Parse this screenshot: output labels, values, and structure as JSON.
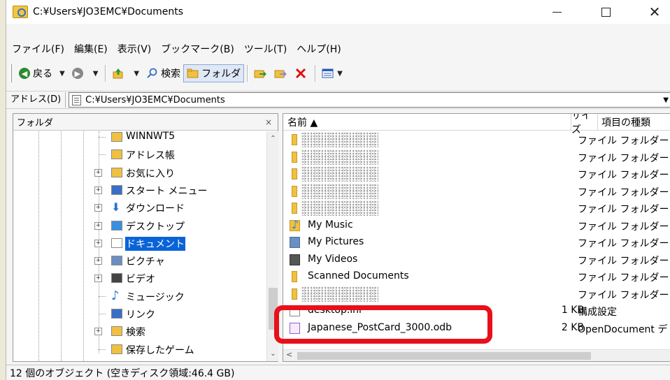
{
  "window": {
    "title": "C:¥Users¥JO3EMC¥Documents",
    "controls": {
      "minimize": "—",
      "maximize": "",
      "close": "✕"
    }
  },
  "menu": [
    "ファイル(F)",
    "編集(E)",
    "表示(V)",
    "ブックマーク(B)",
    "ツール(T)",
    "ヘルプ(H)"
  ],
  "toolbar": {
    "back_label": "戻る",
    "search_label": "検索",
    "folders_label": "フォルダ"
  },
  "address": {
    "label": "アドレス(D)",
    "value": "C:¥Users¥JO3EMC¥Documents"
  },
  "folder_pane": {
    "title": "フォルダ",
    "close": "×",
    "items": [
      {
        "label": "WINNWT5",
        "expander": false,
        "icon": "folder-icon"
      },
      {
        "label": "アドレス帳",
        "expander": false,
        "icon": "address-book-icon"
      },
      {
        "label": "お気に入り",
        "expander": true,
        "icon": "favorites-icon"
      },
      {
        "label": "スタート メニュー",
        "expander": true,
        "icon": "start-menu-icon"
      },
      {
        "label": "ダウンロード",
        "expander": true,
        "icon": "download-icon"
      },
      {
        "label": "デスクトップ",
        "expander": true,
        "icon": "desktop-icon"
      },
      {
        "label": "ドキュメント",
        "expander": true,
        "icon": "documents-icon",
        "selected": true
      },
      {
        "label": "ピクチャ",
        "expander": true,
        "icon": "pictures-icon"
      },
      {
        "label": "ビデオ",
        "expander": true,
        "icon": "videos-icon"
      },
      {
        "label": "ミュージック",
        "expander": false,
        "icon": "music-icon"
      },
      {
        "label": "リンク",
        "expander": false,
        "icon": "links-icon"
      },
      {
        "label": "検索",
        "expander": true,
        "icon": "search-folder-icon"
      },
      {
        "label": "保存したゲーム",
        "expander": false,
        "icon": "saved-games-icon"
      }
    ]
  },
  "file_pane": {
    "columns": {
      "name": "名前 ▲",
      "size": "サイズ",
      "type": "項目の種類"
    },
    "rows": [
      {
        "name": "",
        "size": "",
        "type": "ファイル フォルダー",
        "icon": "folder-icon",
        "blurred": true
      },
      {
        "name": "",
        "size": "",
        "type": "ファイル フォルダー",
        "icon": "folder-icon",
        "blurred": true
      },
      {
        "name": "",
        "size": "",
        "type": "ファイル フォルダー",
        "icon": "folder-icon",
        "blurred": true
      },
      {
        "name": "",
        "size": "",
        "type": "ファイル フォルダー",
        "icon": "folder-icon",
        "blurred": true
      },
      {
        "name": "",
        "size": "",
        "type": "ファイル フォルダー",
        "icon": "folder-icon",
        "blurred": true
      },
      {
        "name": "My Music",
        "size": "",
        "type": "ファイル フォルダー",
        "icon": "music-folder-icon"
      },
      {
        "name": "My Pictures",
        "size": "",
        "type": "ファイル フォルダー",
        "icon": "pictures-folder-icon"
      },
      {
        "name": "My Videos",
        "size": "",
        "type": "ファイル フォルダー",
        "icon": "videos-folder-icon"
      },
      {
        "name": "Scanned Documents",
        "size": "",
        "type": "ファイル フォルダー",
        "icon": "folder-icon"
      },
      {
        "name": "",
        "size": "",
        "type": "ファイル フォルダー",
        "icon": "folder-icon",
        "blurred": true
      },
      {
        "name": "desktop.ini",
        "size": "1 KB",
        "type": "構成設定",
        "icon": "ini-file-icon"
      },
      {
        "name": "Japanese_PostCard_3000.odb",
        "size": "2 KB",
        "type": "OpenDocument デ",
        "icon": "odb-file-icon"
      }
    ]
  },
  "status": "12 個のオブジェクト (空きディスク領域:46.4 GB)",
  "colors": {
    "selection": "#0a64d8",
    "highlight": "#e8101a",
    "folder": "#f0c040"
  }
}
